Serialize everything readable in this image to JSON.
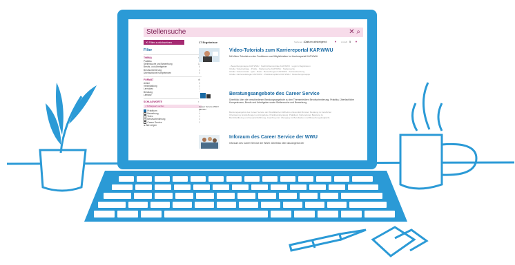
{
  "search": {
    "query": "Stellensuche",
    "clear_icon": "close-icon",
    "search_icon": "search-icon"
  },
  "toolbar": {
    "reset_label": "Filter zurücksetzen",
    "result_count": "17 Ergebnisse",
    "sort_label": "Sortieren nach",
    "sort_value": "Datum absteigend",
    "per_page_label": "Anzahl",
    "per_page_value": "5"
  },
  "sidebar": {
    "title": "Filter",
    "groups": [
      {
        "name": "THEMA",
        "items": [
          {
            "label": "Praktika",
            "count": "3"
          },
          {
            "label": "Stellensuche und Bewerbung",
            "count": "11"
          },
          {
            "label": "Berufs- und Arbeitgeber",
            "count": "6"
          },
          {
            "label": "Berufsorientierung",
            "count": "4"
          },
          {
            "label": "Überfachliche Kompetenzen",
            "count": "5"
          }
        ]
      },
      {
        "name": "FORMAT",
        "items": [
          {
            "label": "Artikel",
            "count": "3"
          },
          {
            "label": "Veranstaltung",
            "count": "2"
          },
          {
            "label": "Lernvideo",
            "count": "1"
          },
          {
            "label": "Beratung",
            "count": "3"
          },
          {
            "label": "Literatur",
            "count": "2"
          }
        ]
      },
      {
        "name": "SCHLAGWORTE",
        "search_placeholder": "Schlagwort suchen",
        "items": [
          {
            "label": "Praktikum",
            "count": "3",
            "checked": true
          },
          {
            "label": "Bewerbung",
            "count": "4",
            "checked": false
          },
          {
            "label": "Video",
            "count": "1",
            "checked": false
          },
          {
            "label": "Berufsorientierung",
            "count": "3",
            "checked": false
          },
          {
            "label": "Career Service",
            "count": "2",
            "checked": false
          },
          {
            "label": "Alle zeigen",
            "count": "",
            "checked": false
          }
        ]
      }
    ]
  },
  "results": [
    {
      "title": "Video-Tutorials zum Karriereportal KAP.WWU",
      "description": "Mit Video-Tutorials zu den Funktionen und Möglichkeiten im Karriereportal KAP.WWU",
      "meta": [
        "...Bewerbungsmappe KAP.WWU · Nachrichtenzentrale KAP.WWU · Login & Registrieren",
        "Inhalte: Videobeiträge · Profile · Stellensuche KAP.WWU · Stellensuche",
        "Inhalte: Videotutorials · Quiz · Basic · Bewerbungen KAP.WWU · Karriereberatung",
        "Inhalte: Karrierestrategie KAP.WWU · Praktikumsplätze KAP.WWU · Bewerbungsmappe"
      ],
      "thumb_icon": "video-thumbnail"
    },
    {
      "title": "Beratungsangebote des Career Service",
      "description": "Überblick über die verschiedenen Beratungsangebote zu den Themenfeldern Berufsorientierung, Praktika, Überfachliche Kompetenzen, Berufs und Arbeitgeber sowie Stellensuche und Bewerbung",
      "meta": [
        "Beratungsangebot des Career Service der Westfälischen Wilhelms-Universität Münster: Beratung zu beruflicher",
        "Orientierung, Empfehlungen und Angebote, Praktikumsberatung, Praktikum Vorbereitung, Beratung zu",
        "Berufsfeldbezug und Gesprächsführung, Coaching zum Übergang ins Berufsleben und Bewerbung (Englisch)"
      ],
      "thumb_label": "Career Service WWU Münster"
    },
    {
      "title": "Inforaum des Career Service der WWU",
      "description": "Inforaum des Career Service der WWU: Überblick über das Angebot der",
      "meta": [],
      "thumb_icon": "people-thumbnail"
    }
  ],
  "colors": {
    "frame": "#2b9ad6",
    "accent": "#a52a72",
    "link": "#1a6aa3"
  }
}
